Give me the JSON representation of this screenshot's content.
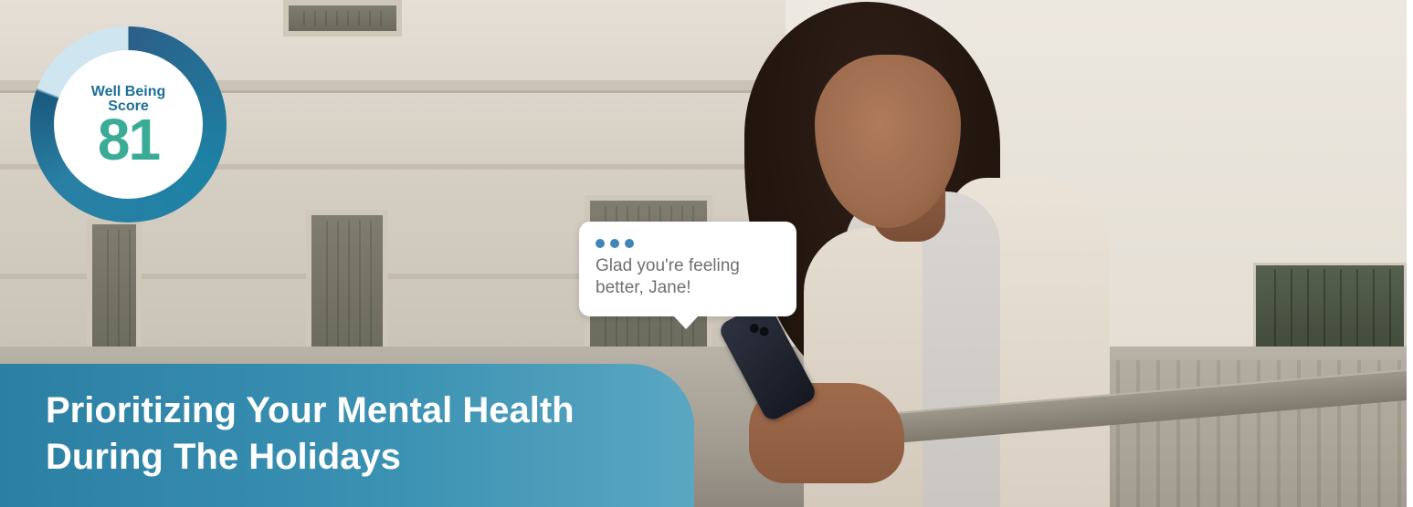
{
  "score_badge": {
    "label": "Well Being\nScore",
    "value": "81",
    "progress_fraction": 0.81,
    "ring_color": "#1d82a5",
    "track_color": "#cfe6f1",
    "value_color": "#3aab97"
  },
  "chat_bubble": {
    "typing_indicator_icon": "typing-dots-icon",
    "message": "Glad you're feeling better, Jane!"
  },
  "headline": {
    "title": "Prioritizing Your Mental Health During The Holidays"
  },
  "colors": {
    "panel": "#2b7fa3",
    "dots": "#3e87b7"
  }
}
